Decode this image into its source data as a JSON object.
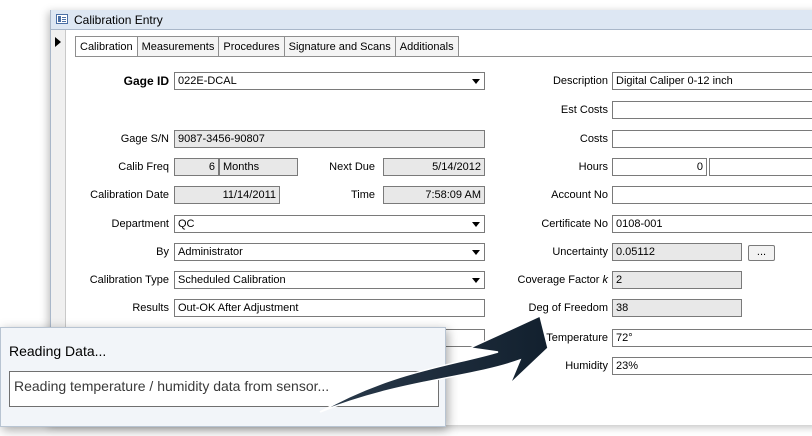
{
  "window": {
    "title": "Calibration Entry"
  },
  "tabs": [
    {
      "label": "Calibration",
      "active": true
    },
    {
      "label": "Measurements",
      "active": false
    },
    {
      "label": "Procedures",
      "active": false
    },
    {
      "label": "Signature and Scans",
      "active": false
    },
    {
      "label": "Additionals",
      "active": false
    }
  ],
  "left": {
    "gage_id": {
      "label": "Gage ID",
      "value": "022E-DCAL"
    },
    "gage_sn": {
      "label": "Gage S/N",
      "value": "9087-3456-90807"
    },
    "calib_freq": {
      "label": "Calib Freq",
      "value": "6",
      "unit": "Months"
    },
    "next_due": {
      "label": "Next Due",
      "value": "5/14/2012"
    },
    "calibration_date": {
      "label": "Calibration Date",
      "value": "11/14/2011"
    },
    "time": {
      "label": "Time",
      "value": "7:58:09 AM"
    },
    "department": {
      "label": "Department",
      "value": "QC"
    },
    "by": {
      "label": "By",
      "value": "Administrator"
    },
    "calibration_type": {
      "label": "Calibration Type",
      "value": "Scheduled Calibration"
    },
    "results": {
      "label": "Results",
      "value": "Out-OK After Adjustment"
    }
  },
  "right": {
    "description": {
      "label": "Description",
      "value": "Digital Caliper 0-12 inch"
    },
    "est_costs": {
      "label": "Est Costs",
      "value": ""
    },
    "costs": {
      "label": "Costs",
      "value": ""
    },
    "hours": {
      "label": "Hours",
      "value": "0",
      "value2": ""
    },
    "account_no": {
      "label": "Account No",
      "value": ""
    },
    "certificate_no": {
      "label": "Certificate No",
      "value": "0108-001"
    },
    "uncertainty": {
      "label": "Uncertainty",
      "value": "0.05112",
      "button": "..."
    },
    "coverage_factor": {
      "label": "Coverage Factor",
      "symbol": "k",
      "value": "2"
    },
    "deg_freedom": {
      "label": "Deg of Freedom",
      "value": "38"
    },
    "temperature": {
      "label": "Temperature",
      "value": "72°"
    },
    "humidity": {
      "label": "Humidity",
      "value": "23%"
    }
  },
  "popup": {
    "title": "Reading Data...",
    "message": "Reading temperature / humidity data from sensor..."
  },
  "icons": {
    "form": "form-icon",
    "record_selector": "record-selector-arrow-icon",
    "dropdown": "chevron-down-icon",
    "callout": "curved-arrow-icon"
  },
  "colors": {
    "titlebar": "#dde7f3",
    "readonly_field": "#e8e8e8",
    "arrow": "#1d2b3a"
  }
}
